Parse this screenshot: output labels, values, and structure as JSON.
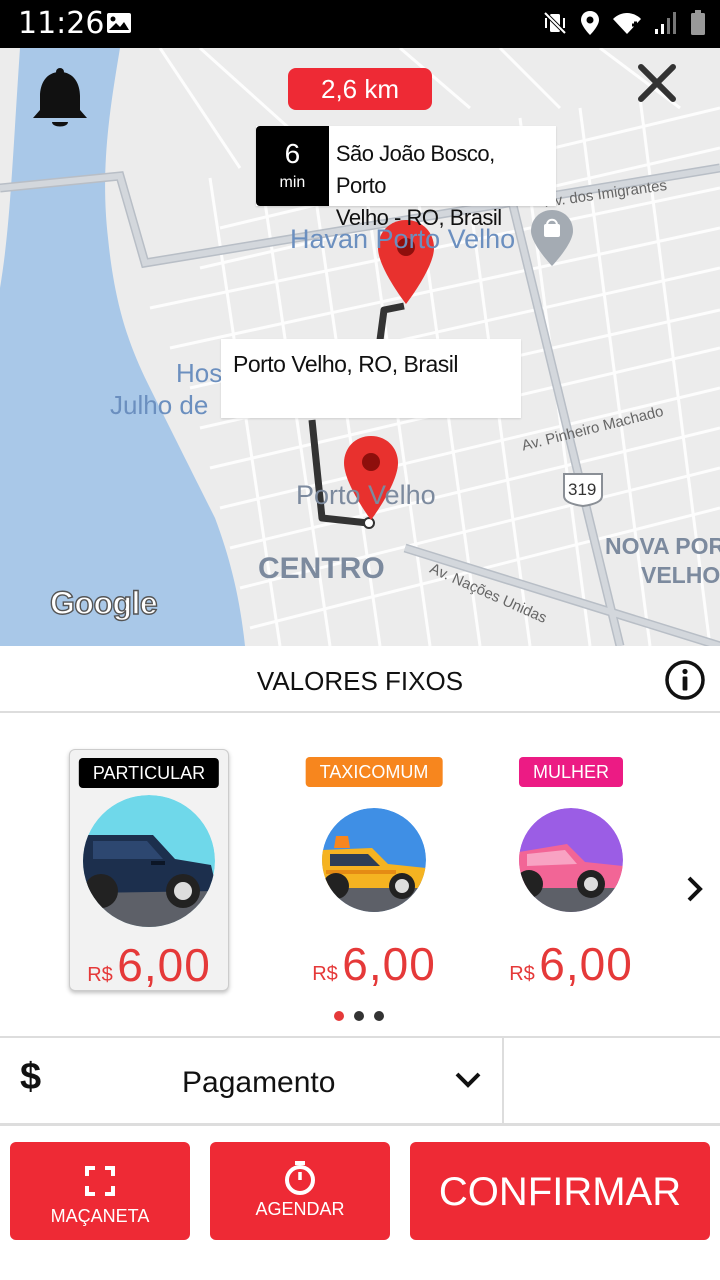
{
  "status_bar": {
    "time": "11:26"
  },
  "map": {
    "distance": "2,6 km",
    "eta": {
      "value": "6",
      "unit": "min"
    },
    "destination_line1": "São João Bosco, Porto",
    "destination_line2": "Velho - RO, Brasil",
    "origin": "Porto Velho, RO, Brasil",
    "labels": {
      "havan": "Havan Porto Velho",
      "hospital_1": "Hos",
      "hospital_2": "Julho de",
      "porto_velho": "Porto Velho",
      "centro": "CENTRO",
      "nova_porto_1": "NOVA POR",
      "nova_porto_2": "VELHO",
      "av_imigrantes": "Av. dos Imigrantes",
      "av_pinheiro": "Av. Pinheiro Machado",
      "av_nacoes": "Av. Nações Unidas",
      "route_319": "319"
    },
    "google": "Google"
  },
  "fixed_values": {
    "title": "VALORES FIXOS",
    "categories": [
      {
        "label": "PARTICULAR",
        "currency": "R$",
        "price": "6,00",
        "badge_color": "#000000",
        "car_color": "#1c2f4d",
        "bg_color": "#6fd8ea"
      },
      {
        "label": "TAXICOMUM",
        "currency": "R$",
        "price": "6,00",
        "badge_color": "#f7861e",
        "car_color": "#f5b321",
        "bg_color": "#3f8fe5"
      },
      {
        "label": "MULHER",
        "currency": "R$",
        "price": "6,00",
        "badge_color": "#ec1b84",
        "car_color": "#f26596",
        "bg_color": "#9b5de5"
      }
    ]
  },
  "payment": {
    "symbol": "$",
    "label": "Pagamento"
  },
  "actions": {
    "macaneta": "MAÇANETA",
    "agendar": "AGENDAR",
    "confirmar": "CONFIRMAR"
  },
  "colors": {
    "accent": "#ee2a35",
    "price": "#e53939"
  }
}
